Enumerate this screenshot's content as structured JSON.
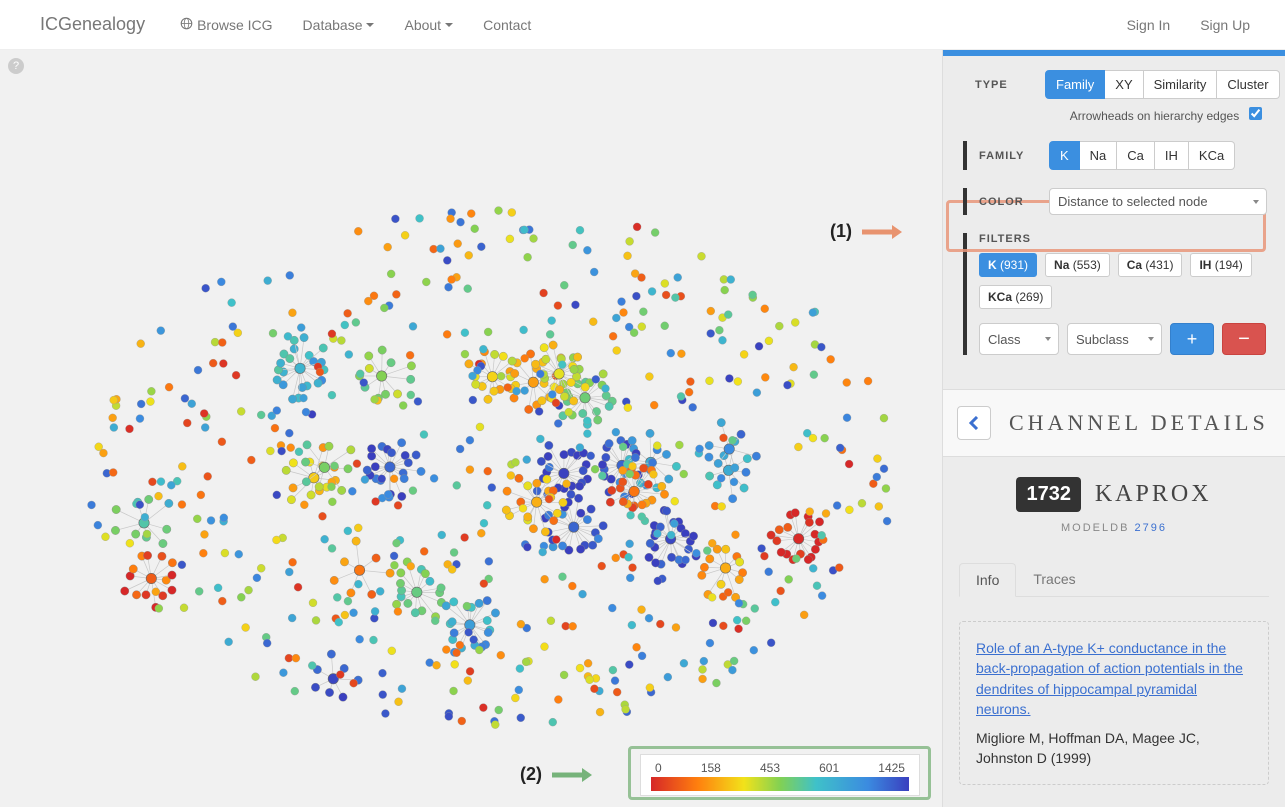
{
  "nav": {
    "brand": "ICGenealogy",
    "browse": "Browse ICG",
    "database": "Database",
    "about": "About",
    "contact": "Contact",
    "signin": "Sign In",
    "signup": "Sign Up"
  },
  "annotations": {
    "a1": "(1)",
    "a2": "(2)"
  },
  "legend": {
    "t0": "0",
    "t1": "158",
    "t2": "453",
    "t3": "601",
    "t4": "1425"
  },
  "panel": {
    "type_label": "Type",
    "type_opts": {
      "family": "Family",
      "xy": "XY",
      "sim": "Similarity",
      "cluster": "Cluster"
    },
    "arrowheads": "Arrowheads on hierarchy edges",
    "family_label": "Family",
    "family_opts": {
      "k": "K",
      "na": "Na",
      "ca": "Ca",
      "ih": "IH",
      "kca": "KCa"
    },
    "color_label": "Color",
    "color_select": "Distance to selected node",
    "filters_label": "Filters",
    "filters": {
      "k_l": "K",
      "k_c": "(931)",
      "na_l": "Na",
      "na_c": "(553)",
      "ca_l": "Ca",
      "ca_c": "(431)",
      "ih_l": "IH",
      "ih_c": "(194)",
      "kca_l": "KCa",
      "kca_c": "(269)"
    },
    "class": "Class",
    "subclass": "Subclass",
    "plus": "+",
    "minus": "−"
  },
  "details": {
    "header": "CHANNEL DETAILS",
    "id": "1732",
    "name": "KAPROX",
    "modeldb_label": "MODELDB",
    "modeldb_id": "2796",
    "tabs": {
      "info": "Info",
      "traces": "Traces"
    },
    "ref_title": "Role of an A-type K+ conductance in the back-propagation of action potentials in the dendrites of hippocampal pyramidal neurons.",
    "ref_authors": "Migliore M, Hoffman DA, Magee JC, Johnston D (1999)"
  },
  "chart_data": {
    "type": "scatter",
    "title": "Family graph colored by distance to selected node (K family)",
    "color_scale": {
      "stops": [
        0,
        158,
        453,
        601,
        1425
      ],
      "colors": [
        "#d62728",
        "#ff7f0e",
        "#f2e21a",
        "#82d153",
        "#3fc1c9",
        "#3b8be0",
        "#3a3fbf"
      ]
    },
    "selected_family": "K",
    "node_count_approx": 931,
    "edges": "family hierarchy (light gray)",
    "x": [],
    "y": []
  }
}
